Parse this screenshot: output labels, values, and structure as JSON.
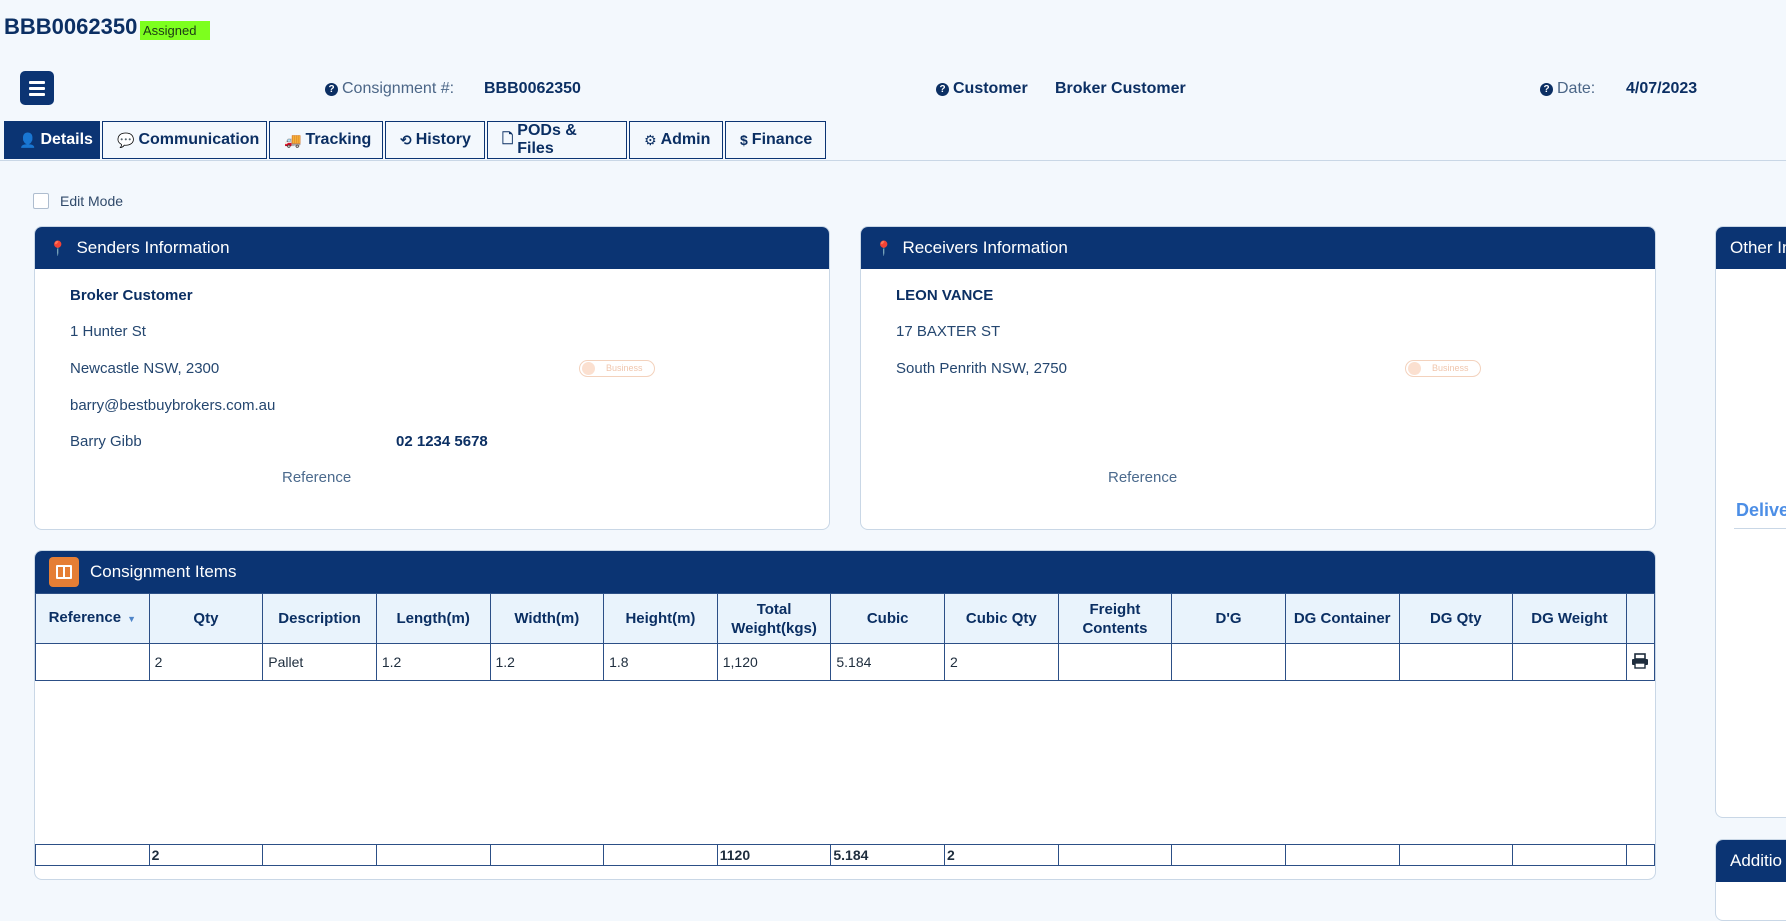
{
  "header": {
    "consignment_id": "BBB0062350",
    "status": "Assigned",
    "consignment_label": "Consignment #:",
    "consignment_value": "BBB0062350",
    "customer_label": "Customer",
    "customer_value": "Broker Customer",
    "date_label": "Date:",
    "date_value": "4/07/2023"
  },
  "tabs": [
    {
      "label": "Details",
      "icon": "user-icon",
      "glyph": "👤",
      "active": true
    },
    {
      "label": "Communication",
      "icon": "comment-icon",
      "glyph": "💬"
    },
    {
      "label": "Tracking",
      "icon": "truck-icon",
      "glyph": "🚚"
    },
    {
      "label": "History",
      "icon": "history-icon",
      "glyph": "⟲"
    },
    {
      "label": "PODs & Files",
      "icon": "file-icon",
      "glyph": "🗋"
    },
    {
      "label": "Admin",
      "icon": "gear-icon",
      "glyph": "⚙"
    },
    {
      "label": "Finance",
      "icon": "dollar-icon",
      "glyph": "$"
    }
  ],
  "edit_mode_label": "Edit Mode",
  "senders": {
    "title": "Senders Information",
    "name": "Broker Customer",
    "address1": "1 Hunter St",
    "address2": "Newcastle NSW, 2300",
    "email": "barry@bestbuybrokers.com.au",
    "contact": "Barry Gibb",
    "phone": "02 1234 5678",
    "toggle_label": "Business",
    "reference_label": "Reference"
  },
  "receivers": {
    "title": "Receivers Information",
    "name": "LEON VANCE",
    "address1": "17 BAXTER ST",
    "address2": "South Penrith NSW, 2750",
    "toggle_label": "Business",
    "reference_label": "Reference"
  },
  "other_panel": {
    "title": "Other In",
    "delivery_label": "Delive"
  },
  "additional_panel": {
    "title": "Additio"
  },
  "items": {
    "title": "Consignment Items",
    "columns": [
      "Reference",
      "Qty",
      "Description",
      "Length(m)",
      "Width(m)",
      "Height(m)",
      "Total Weight(kgs)",
      "Cubic",
      "Cubic Qty",
      "Freight Contents",
      "D'G",
      "DG Container",
      "DG Qty",
      "DG Weight"
    ],
    "rows": [
      [
        "",
        "2",
        "Pallet",
        "1.2",
        "1.2",
        "1.8",
        "1,120",
        "5.184",
        "2",
        "",
        "",
        "",
        "",
        ""
      ]
    ],
    "totals": [
      "",
      "2",
      "",
      "",
      "",
      "",
      "1120",
      "5.184",
      "2",
      "",
      "",
      "",
      "",
      ""
    ]
  },
  "colors": {
    "primary": "#0b3473",
    "accent_orange": "#e57e35",
    "status_green": "#7dff1e",
    "link_blue": "#4c8ee6"
  }
}
